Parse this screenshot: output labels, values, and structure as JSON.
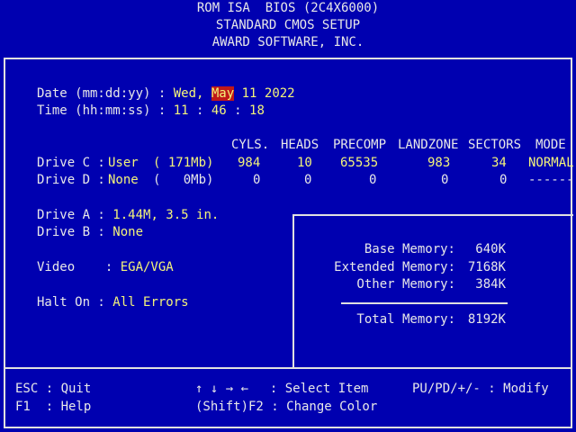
{
  "header": {
    "line1": "ROM ISA  BIOS (2C4X6000)",
    "line2": "STANDARD CMOS SETUP",
    "line3": "AWARD SOFTWARE, INC."
  },
  "datetime": {
    "date_label": "Date (mm:dd:yy) : ",
    "weekday": "Wed, ",
    "month": "May",
    "day_year": " 11 2022",
    "time_label": "Time (hh:mm:ss) : ",
    "hour": "11",
    "sep1": " : ",
    "minute": "46",
    "sep2": " : ",
    "second": "18"
  },
  "drives_table": {
    "headers": [
      "CYLS.",
      "HEADS",
      "PRECOMP",
      "LANDZONE",
      "SECTORS",
      "MODE"
    ],
    "rows": [
      {
        "label": "Drive C : ",
        "type": "User",
        "size": "( 171Mb)",
        "cyls": "984",
        "heads": "10",
        "precomp": "65535",
        "landzone": "983",
        "sectors": "34",
        "mode": "NORMAL"
      },
      {
        "label": "Drive D : ",
        "type": "None",
        "size": "(   0Mb)",
        "cyls": "0",
        "heads": "0",
        "precomp": "0",
        "landzone": "0",
        "sectors": "0",
        "mode": "------"
      }
    ]
  },
  "settings": {
    "drive_a_label": "Drive A : ",
    "drive_a_value": "1.44M, 3.5 in.",
    "drive_b_label": "Drive B : ",
    "drive_b_value": "None",
    "video_label": "Video    : ",
    "video_value": "EGA/VGA",
    "halt_label": "Halt On : ",
    "halt_value": "All Errors"
  },
  "memory": {
    "base_label": "Base Memory:",
    "base_value": "640K",
    "extended_label": "Extended Memory:",
    "extended_value": "7168K",
    "other_label": "Other Memory:",
    "other_value": "384K",
    "total_label": "Total Memory:",
    "total_value": "8192K"
  },
  "footer": {
    "esc_key": "ESC : Quit",
    "f1_key": "F1  : Help",
    "arrows": "↑ ↓ → ←",
    "select_item": "  : Select Item",
    "shift_f2": "(Shift)F2 : Change Color",
    "modify": "PU/PD/+/- : Modify"
  },
  "colors": {
    "background": "#0000b0",
    "value_text": "#f4f47a",
    "label_text": "#e8e8e8",
    "highlight_bg": "#c01818"
  }
}
